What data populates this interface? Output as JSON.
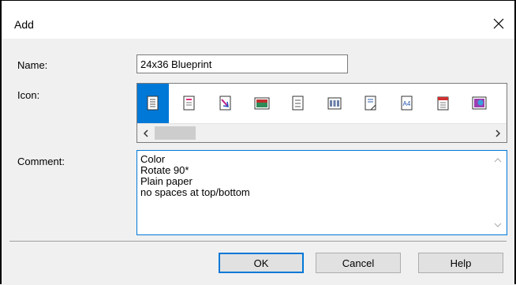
{
  "dialog": {
    "title": "Add"
  },
  "labels": {
    "name": "Name:",
    "icon": "Icon:",
    "comment": "Comment:"
  },
  "name_field": {
    "value": "24x36 Blueprint"
  },
  "icon_picker": {
    "selected_index": 0,
    "icons": [
      "document-icon",
      "document-pink-icon",
      "document-arrow-icon",
      "image-icon",
      "document-lines-icon",
      "grid-icon",
      "document-fold-icon",
      "a4-icon",
      "calendar-icon",
      "photo-icon"
    ]
  },
  "comment_field": {
    "value": "Color\nRotate 90*\nPlain paper\nno spaces at top/bottom"
  },
  "buttons": {
    "ok": "OK",
    "cancel": "Cancel",
    "help": "Help"
  },
  "colors": {
    "accent": "#0078d7",
    "dialog_bg": "#f0f0f0",
    "button_bg": "#e1e1e1"
  }
}
